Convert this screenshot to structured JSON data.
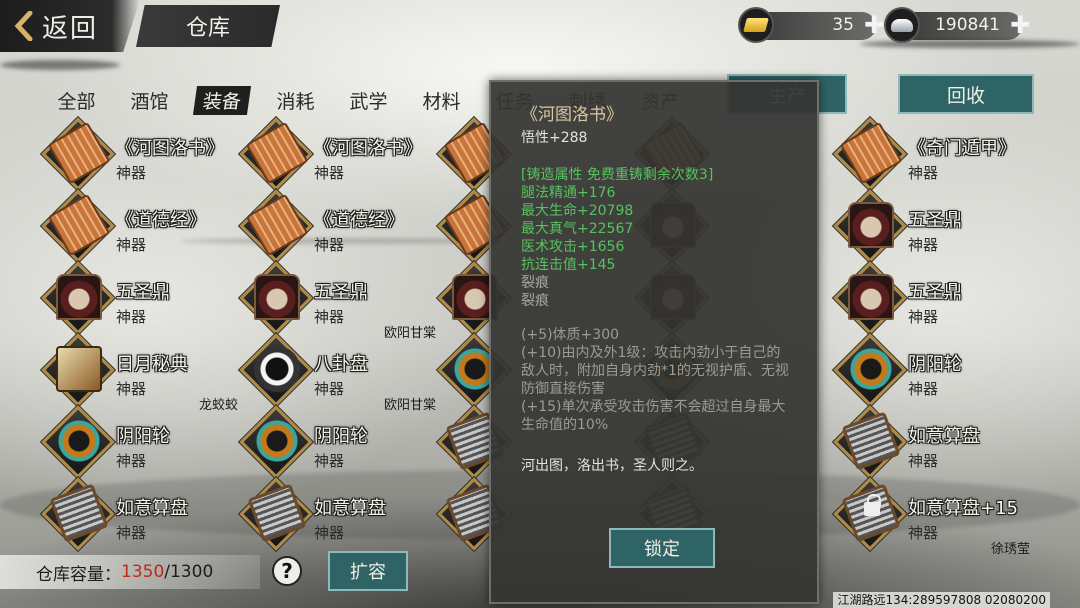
{
  "header": {
    "back_label": "返回",
    "title": "仓库",
    "currencies": [
      {
        "icon": "gold-ingot-icon",
        "amount": "35"
      },
      {
        "icon": "silver-ingot-icon",
        "amount": "190841"
      }
    ]
  },
  "categories": [
    "全部",
    "酒馆",
    "装备",
    "消耗",
    "武学",
    "材料",
    "任务",
    "刺绣",
    "资产"
  ],
  "active_category": "装备",
  "buttons": {
    "produce": "生产",
    "recycle": "回收",
    "expand": "扩容",
    "lock": "锁定"
  },
  "items": [
    [
      {
        "name": "《河图洛书》",
        "type": "神器",
        "icon": "scroll-icon",
        "owner": ""
      },
      {
        "name": "《河图洛书》",
        "type": "神器",
        "icon": "scroll-icon",
        "owner": ""
      },
      {
        "name": "",
        "type": "",
        "icon": "scroll-icon",
        "owner": ""
      },
      {
        "name": "",
        "type": "",
        "icon": "scroll-icon",
        "owner": ""
      },
      {
        "name": "《奇门遁甲》",
        "type": "神器",
        "icon": "scroll-icon",
        "owner": ""
      }
    ],
    [
      {
        "name": "《道德经》",
        "type": "神器",
        "icon": "scroll-icon",
        "owner": ""
      },
      {
        "name": "《道德经》",
        "type": "神器",
        "icon": "scroll-icon",
        "owner": ""
      },
      {
        "name": "",
        "type": "",
        "icon": "scroll-icon",
        "owner": ""
      },
      {
        "name": "",
        "type": "",
        "icon": "tower-icon",
        "owner": ""
      },
      {
        "name": "五圣鼎",
        "type": "神器",
        "icon": "tower-icon",
        "owner": ""
      }
    ],
    [
      {
        "name": "五圣鼎",
        "type": "神器",
        "icon": "tower-icon",
        "owner": ""
      },
      {
        "name": "五圣鼎",
        "type": "神器",
        "icon": "tower-icon",
        "owner": "欧阳甘棠"
      },
      {
        "name": "",
        "type": "",
        "icon": "tower-icon",
        "owner": ""
      },
      {
        "name": "",
        "type": "",
        "icon": "tower-icon",
        "owner": ""
      },
      {
        "name": "五圣鼎",
        "type": "神器",
        "icon": "tower-icon",
        "owner": ""
      }
    ],
    [
      {
        "name": "日月秘典",
        "type": "神器",
        "icon": "book-icon",
        "owner": "龙蛟蛟"
      },
      {
        "name": "八卦盘",
        "type": "神器",
        "icon": "bagua-icon",
        "owner": "欧阳甘棠"
      },
      {
        "name": "",
        "type": "",
        "icon": "yinyang-wheel-icon",
        "owner": ""
      },
      {
        "name": "",
        "type": "",
        "icon": "yinyang-wheel-icon",
        "owner": ""
      },
      {
        "name": "阴阳轮",
        "type": "神器",
        "icon": "yinyang-wheel-icon",
        "owner": ""
      }
    ],
    [
      {
        "name": "阴阳轮",
        "type": "神器",
        "icon": "yinyang-wheel-icon",
        "owner": ""
      },
      {
        "name": "阴阳轮",
        "type": "神器",
        "icon": "yinyang-wheel-icon",
        "owner": ""
      },
      {
        "name": "",
        "type": "",
        "icon": "abacus-icon",
        "owner": ""
      },
      {
        "name": "",
        "type": "",
        "icon": "abacus-icon",
        "owner": ""
      },
      {
        "name": "如意算盘",
        "type": "神器",
        "icon": "abacus-icon",
        "owner": ""
      }
    ],
    [
      {
        "name": "如意算盘",
        "type": "神器",
        "icon": "abacus-icon",
        "owner": ""
      },
      {
        "name": "如意算盘",
        "type": "神器",
        "icon": "abacus-icon",
        "owner": ""
      },
      {
        "name": "",
        "type": "",
        "icon": "abacus-icon",
        "owner": ""
      },
      {
        "name": "",
        "type": "",
        "icon": "abacus-icon",
        "owner": ""
      },
      {
        "name": "如意算盘+15",
        "type": "神器",
        "icon": "abacus-icon",
        "owner": "徐琇莹",
        "locked": true
      }
    ]
  ],
  "tooltip": {
    "title": "《河图洛书》",
    "base_stat": "悟性+288",
    "forge_header": "[铸造属性  免费重铸剩余次数3]",
    "forge_stats": [
      "腿法精通+176",
      "最大生命+20798",
      "最大真气+22567",
      "医术攻击+1656",
      "抗连击值+145"
    ],
    "cracks": [
      "裂痕",
      "裂痕"
    ],
    "effects": [
      "(+5)体质+300",
      "(+10)由内及外1级：攻击内劲小于自己的敌人时，附加自身内劲*1的无视护盾、无视防御直接伤害",
      "(+15)单次承受攻击伤害不会超过自身最大生命值的10%"
    ],
    "description": "河出图，洛出书，圣人则之。"
  },
  "capacity": {
    "label": "仓库容量：",
    "used": "1350",
    "total": "/1300"
  },
  "server_id": "江湖路远134:289597808 02080200",
  "colors": {
    "accent_button": "#2f6466",
    "green_stat": "#55c35e",
    "capacity_over": "#c0281e"
  }
}
